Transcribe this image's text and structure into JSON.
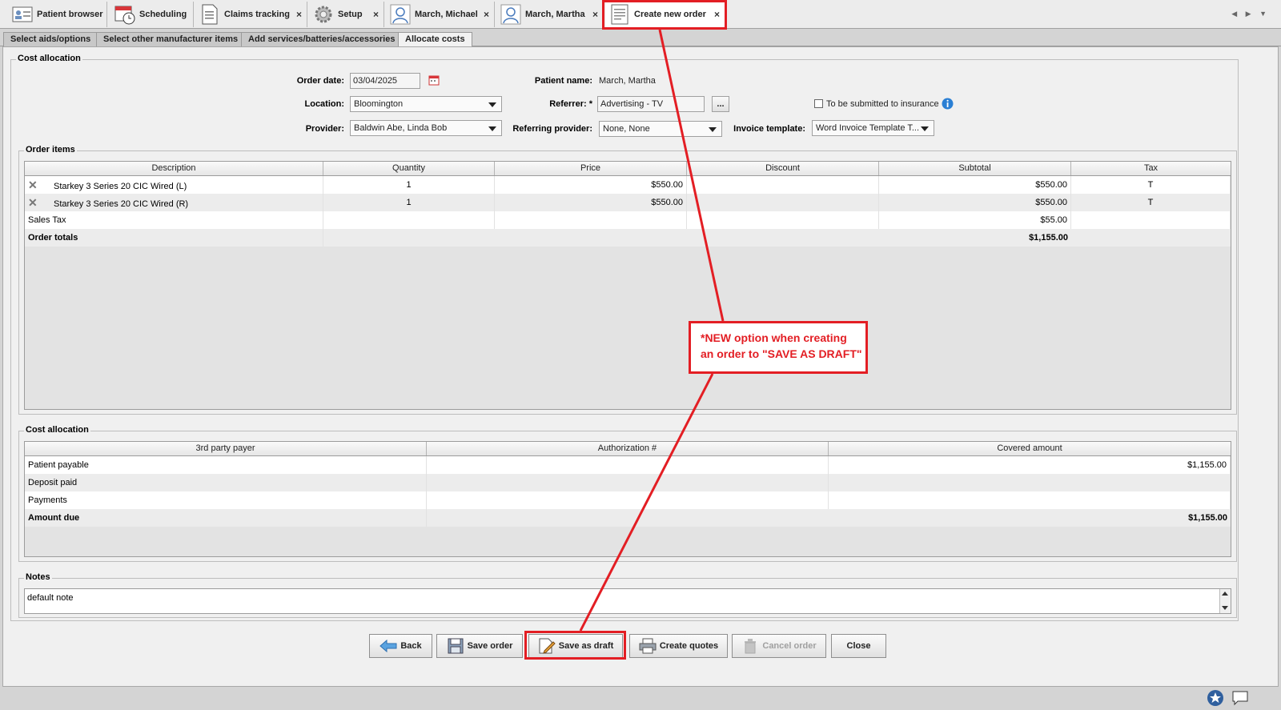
{
  "top_tabs": [
    {
      "label": "Patient browser",
      "icon": "patient-card-icon"
    },
    {
      "label": "Scheduling",
      "icon": "calendar-clock-icon"
    },
    {
      "label": "Claims tracking",
      "icon": "document-icon"
    },
    {
      "label": "Setup",
      "icon": "gear-icon"
    },
    {
      "label": "March, Michael",
      "icon": "person-icon"
    },
    {
      "label": "March, Martha",
      "icon": "person-icon"
    },
    {
      "label": "Create new order",
      "icon": "order-form-icon"
    }
  ],
  "close_glyph": "×",
  "sub_tabs": [
    "Select aids/options",
    "Select other manufacturer items",
    "Add services/batteries/accessories",
    "Allocate costs"
  ],
  "header_group": {
    "title": "Cost allocation",
    "order_date_label": "Order date:",
    "order_date_value": "03/04/2025",
    "patient_name_label": "Patient name:",
    "patient_name_value": "March, Martha",
    "location_label": "Location:",
    "location_value": "Bloomington",
    "referrer_label": "Referrer: *",
    "referrer_value": "Advertising - TV",
    "browse_label": "...",
    "insurance_label": "To be submitted to insurance",
    "provider_label": "Provider:",
    "provider_value": "Baldwin Abe, Linda Bob",
    "referring_provider_label": "Referring provider:",
    "referring_provider_value": "None, None",
    "invoice_template_label": "Invoice template:",
    "invoice_template_value": "Word Invoice Template T..."
  },
  "order_items": {
    "title": "Order items",
    "columns": [
      "Description",
      "Quantity",
      "Price",
      "Discount",
      "Subtotal",
      "Tax"
    ],
    "rows": [
      {
        "description": "Starkey 3 Series 20 CIC Wired (L)",
        "quantity": "1",
        "price": "$550.00",
        "discount": "",
        "subtotal": "$550.00",
        "tax": "T"
      },
      {
        "description": "Starkey 3 Series 20 CIC Wired (R)",
        "quantity": "1",
        "price": "$550.00",
        "discount": "",
        "subtotal": "$550.00",
        "tax": "T"
      }
    ],
    "sales_tax_label": "Sales Tax",
    "sales_tax_value": "$55.00",
    "totals_label": "Order totals",
    "totals_value": "$1,155.00"
  },
  "cost_allocation": {
    "title": "Cost allocation",
    "columns": [
      "3rd party payer",
      "Authorization #",
      "Covered amount"
    ],
    "rows": [
      {
        "payer": "Patient payable",
        "auth": "",
        "amount": "$1,155.00"
      },
      {
        "payer": "Deposit paid",
        "auth": "",
        "amount": ""
      },
      {
        "payer": "Payments",
        "auth": "",
        "amount": ""
      }
    ],
    "amount_due_label": "Amount due",
    "amount_due_value": "$1,155.00"
  },
  "notes": {
    "title": "Notes",
    "value": "default note"
  },
  "buttons": {
    "back": "Back",
    "save_order": "Save order",
    "save_as_draft": "Save as draft",
    "create_quotes": "Create quotes",
    "cancel_order": "Cancel order",
    "close": "Close"
  },
  "annotation": {
    "line1": "*NEW option when creating",
    "line2": "an order to \"SAVE AS DRAFT\""
  },
  "colors": {
    "annotation_red": "#e31e24",
    "info_blue": "#2a7fd4"
  }
}
